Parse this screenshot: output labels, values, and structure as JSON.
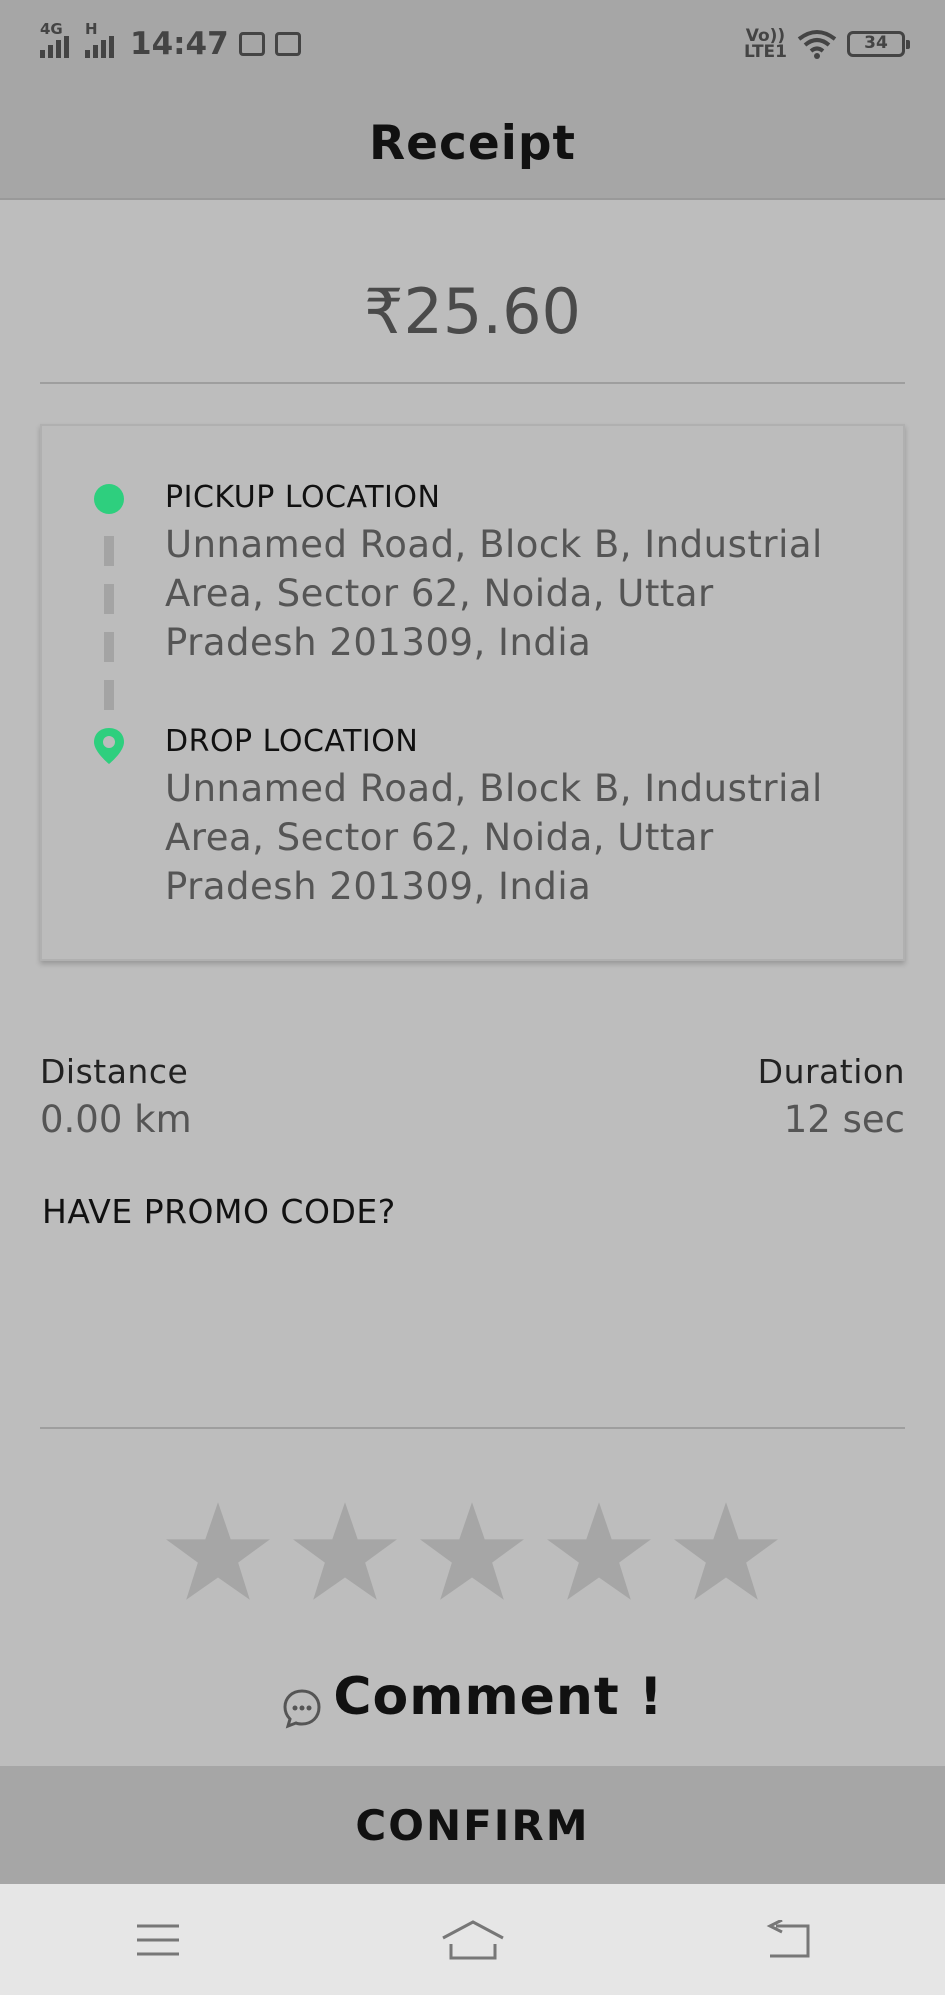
{
  "status_bar": {
    "network_1": "4G",
    "network_2": "H",
    "time": "14:47",
    "volte": "Vo))",
    "lte": "LTE1",
    "battery": "34"
  },
  "header": {
    "title": "Receipt"
  },
  "fare": {
    "amount": "₹25.60"
  },
  "trip": {
    "pickup_label": "PICKUP LOCATION",
    "pickup_address": "Unnamed Road, Block B, Industrial Area, Sector 62, Noida, Uttar Pradesh 201309, India",
    "drop_label": "DROP LOCATION",
    "drop_address": "Unnamed Road, Block B, Industrial Area, Sector 62, Noida, Uttar Pradesh 201309, India"
  },
  "stats": {
    "distance_label": "Distance",
    "distance_value": "0.00 km",
    "duration_label": "Duration",
    "duration_value": "12 sec"
  },
  "promo": {
    "label": "HAVE PROMO CODE?"
  },
  "rating": {
    "max": 5,
    "value": 0
  },
  "comment": {
    "label": "Comment !"
  },
  "actions": {
    "confirm_label": "CONFIRM"
  },
  "icons": {
    "pickup": "green-dot-icon",
    "drop": "location-pin-icon",
    "comment": "chat-bubble-icon",
    "nav_menu": "menu-icon",
    "nav_home": "home-icon",
    "nav_back": "back-icon"
  },
  "colors": {
    "accent": "#2ecf7e",
    "star_empty": "#a6a6a6"
  }
}
